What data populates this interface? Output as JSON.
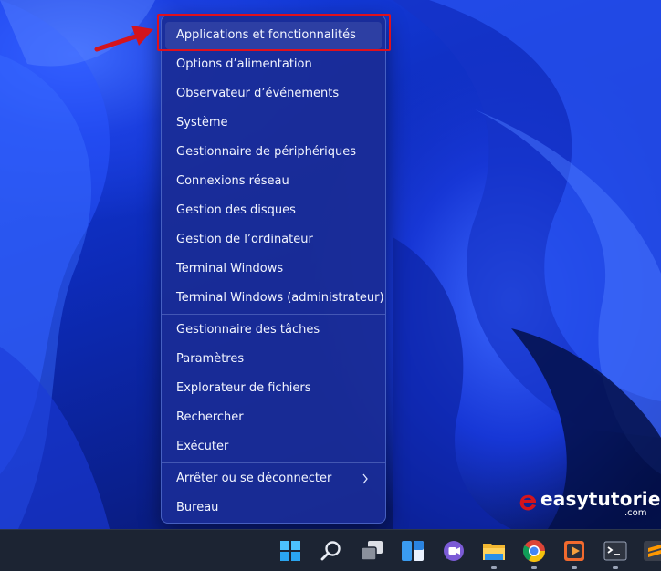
{
  "menu": {
    "items": [
      {
        "label": "Applications et fonctionnalités"
      },
      {
        "label": "Options d’alimentation"
      },
      {
        "label": "Observateur d’événements"
      },
      {
        "label": "Système"
      },
      {
        "label": "Gestionnaire de périphériques"
      },
      {
        "label": "Connexions réseau"
      },
      {
        "label": "Gestion des disques"
      },
      {
        "label": "Gestion de l’ordinateur"
      },
      {
        "label": "Terminal Windows"
      },
      {
        "label": "Terminal Windows (administrateur)"
      },
      {
        "label": "Gestionnaire des tâches"
      },
      {
        "label": "Paramètres"
      },
      {
        "label": "Explorateur de fichiers"
      },
      {
        "label": "Rechercher"
      },
      {
        "label": "Exécuter"
      },
      {
        "label": "Arrêter ou se déconnecter"
      },
      {
        "label": "Bureau"
      }
    ]
  },
  "watermark": {
    "name": "easytutoriel",
    "tld": ".com"
  },
  "taskbar": {
    "icons": [
      "start-icon",
      "search-icon",
      "task-view-icon",
      "widgets-icon",
      "teams-chat-icon",
      "file-explorer-icon",
      "chrome-icon",
      "media-player-icon",
      "terminal-icon",
      "sublime-text-icon"
    ]
  },
  "colors": {
    "highlight": "#e0101c",
    "menu_bg": "#1a2c96",
    "taskbar_bg": "#1c2433"
  }
}
